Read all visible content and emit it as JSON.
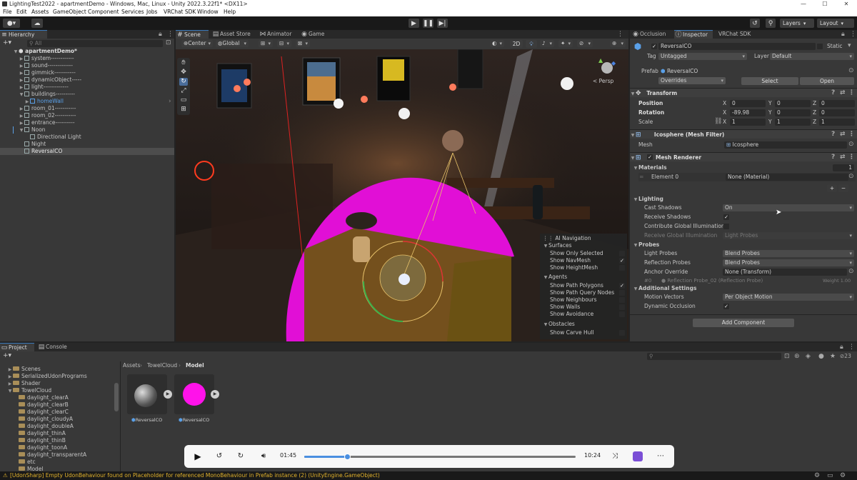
{
  "window": {
    "title": "LightingTest2022 - apartmentDemo - Windows, Mac, Linux - Unity 2022.3.22f1* <DX11>",
    "controls": [
      "—",
      "☐",
      "✕"
    ]
  },
  "menu": [
    "File",
    "Edit",
    "Assets",
    "GameObject",
    "Component",
    "Services",
    "Jobs",
    "VRChat SDK",
    "Window",
    "Help"
  ],
  "toolbar": {
    "layers": "Layers",
    "layout": "Layout"
  },
  "hierarchy": {
    "tab": "Hierarchy",
    "search_placeholder": "All",
    "items": [
      {
        "label": "apartmentDemo*"
      },
      {
        "label": "system------------"
      },
      {
        "label": "sound-------------"
      },
      {
        "label": "gimmick-----------"
      },
      {
        "label": "dynamicObject-----"
      },
      {
        "label": "light-------------"
      },
      {
        "label": "buildings----------"
      },
      {
        "label": "homeWall"
      },
      {
        "label": "room_01-----------"
      },
      {
        "label": "room_02-----------"
      },
      {
        "label": "entrance----------"
      },
      {
        "label": "Noon"
      },
      {
        "label": "Directional Light"
      },
      {
        "label": "Night"
      },
      {
        "label": "ReversalCO"
      }
    ]
  },
  "scene_tabs": [
    "Scene",
    "Asset Store",
    "Animator",
    "Game"
  ],
  "scene_toolbar": {
    "pivot": "Center",
    "space": "Global",
    "mode2d": "2D"
  },
  "scene": {
    "persp": "< Persp",
    "overlay": {
      "title": "AI Navigation",
      "sections": [
        {
          "title": "Surfaces",
          "items": [
            {
              "label": "Show Only Selected",
              "checked": ""
            },
            {
              "label": "Show NavMesh",
              "checked": "✓"
            },
            {
              "label": "Show HeightMesh",
              "checked": ""
            }
          ]
        },
        {
          "title": "Agents",
          "items": [
            {
              "label": "Show Path Polygons",
              "checked": "✓"
            },
            {
              "label": "Show Path Query Nodes",
              "checked": ""
            },
            {
              "label": "Show Neighbours",
              "checked": ""
            },
            {
              "label": "Show Walls",
              "checked": ""
            },
            {
              "label": "Show Avoidance",
              "checked": ""
            }
          ]
        },
        {
          "title": "Obstacles",
          "items": [
            {
              "label": "Show Carve Hull",
              "checked": ""
            }
          ]
        }
      ]
    }
  },
  "inspector": {
    "tabs": [
      "Occlusion",
      "Inspector",
      "VRChat SDK"
    ],
    "object": {
      "active_check": "✓",
      "name": "ReversalCO",
      "static_label": "Static",
      "tag_label": "Tag",
      "tag": "Untagged",
      "layer_label": "Layer",
      "layer": "Default",
      "prefab_label": "Prefab",
      "prefab": "ReversalCO",
      "overrides": "Overrides",
      "select": "Select",
      "open": "Open"
    },
    "transform": {
      "title": "Transform",
      "rows": [
        {
          "label": "Position",
          "x": "0",
          "y": "0",
          "z": "0"
        },
        {
          "label": "Rotation",
          "x": "-89.98",
          "y": "0",
          "z": "0"
        },
        {
          "label": "Scale",
          "x": "1",
          "y": "1",
          "z": "1"
        }
      ],
      "axis": [
        "X",
        "Y",
        "Z"
      ]
    },
    "mesh_filter": {
      "title": "Icosphere (Mesh Filter)",
      "mesh_label": "Mesh",
      "mesh": "Icosphere"
    },
    "mesh_renderer": {
      "title": "Mesh Renderer",
      "enabled": "✓",
      "materials_label": "Materials",
      "materials_count": "1",
      "element_label": "Element 0",
      "element_value": "None (Material)",
      "plus": "+",
      "minus": "−",
      "lighting_label": "Lighting",
      "cast_shadows_label": "Cast Shadows",
      "cast_shadows": "On",
      "receive_shadows_label": "Receive Shadows",
      "receive_shadows": "✓",
      "contribute_gi_label": "Contribute Global Illumination",
      "contribute_gi": "",
      "receive_gi_label": "Receive Global Illumination",
      "receive_gi": "Light Probes",
      "probes_label": "Probes",
      "light_probes_label": "Light Probes",
      "light_probes": "Blend Probes",
      "reflection_probes_label": "Reflection Probes",
      "reflection_probes": "Blend Probes",
      "anchor_label": "Anchor Override",
      "anchor": "None (Transform)",
      "probe_index": "#0",
      "probe_ref": "Reflection Probe_02 (Reflection Probe)",
      "weight": "Weight 1.00",
      "additional_label": "Additional Settings",
      "motion_vectors_label": "Motion Vectors",
      "motion_vectors": "Per Object Motion",
      "dynamic_occlusion_label": "Dynamic Occlusion",
      "dynamic_occlusion": "✓"
    },
    "add_component": "Add Component"
  },
  "project": {
    "tabs": [
      "Project",
      "Console"
    ],
    "tree": [
      {
        "label": "Scenes"
      },
      {
        "label": "SerializedUdonPrograms"
      },
      {
        "label": "Shader"
      },
      {
        "label": "TowelCloud"
      },
      {
        "label": "daylight_clearA"
      },
      {
        "label": "daylight_clearB"
      },
      {
        "label": "daylight_clearC"
      },
      {
        "label": "daylight_cloudyA"
      },
      {
        "label": "daylight_doubleA"
      },
      {
        "label": "daylight_thinA"
      },
      {
        "label": "daylight_thinB"
      },
      {
        "label": "daylight_toonA"
      },
      {
        "label": "daylight_transparentA"
      },
      {
        "label": "etc"
      },
      {
        "label": "Model"
      }
    ],
    "breadcrumb": [
      "Assets",
      "TowelCloud",
      "Model"
    ],
    "assets": [
      {
        "label": "ReversalCO"
      },
      {
        "label": "ReversalCO"
      }
    ],
    "count": "23"
  },
  "player": {
    "current": "01:45",
    "duration": "10:24",
    "progress": 0.16
  },
  "status": "[UdonSharp] Empty UdonBehaviour found on Placeholder for referenced MonoBehaviour in Prefab instance (2) (UnityEngine.GameObject)"
}
